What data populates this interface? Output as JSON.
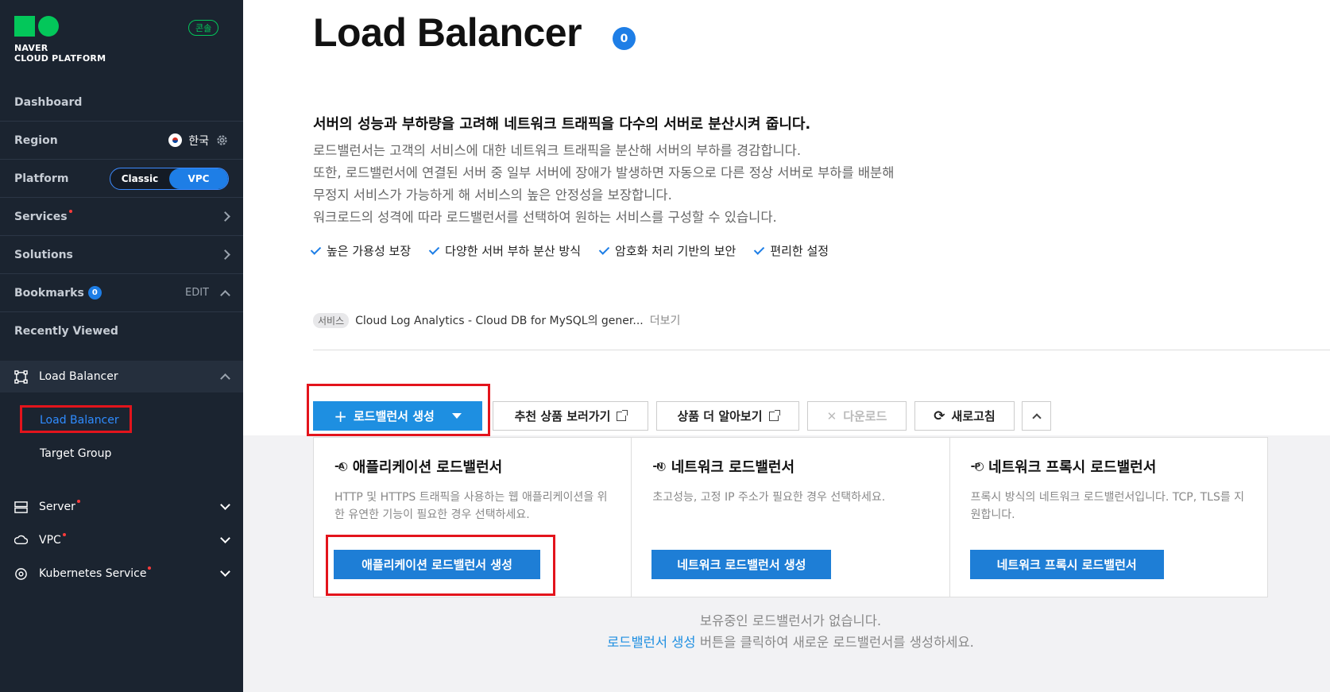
{
  "sidebar": {
    "logo_line1": "NAVER",
    "logo_line2": "CLOUD PLATFORM",
    "console_badge": "콘솔",
    "dashboard": "Dashboard",
    "region_label": "Region",
    "region_value": "한국",
    "platform_label": "Platform",
    "platform_options": [
      "Classic",
      "VPC"
    ],
    "platform_selected": "VPC",
    "services": "Services",
    "solutions": "Solutions",
    "bookmarks": "Bookmarks",
    "bookmarks_count": "0",
    "bookmarks_edit": "EDIT",
    "recently_viewed": "Recently Viewed",
    "current_service": "Load Balancer",
    "sub_items": [
      "Load Balancer",
      "Target Group"
    ],
    "service_list": [
      {
        "label": "Server",
        "icon": "server-icon"
      },
      {
        "label": "VPC",
        "icon": "vpc-icon"
      },
      {
        "label": "Kubernetes Service",
        "icon": "kubernetes-icon"
      }
    ]
  },
  "main": {
    "title": "Load Balancer",
    "count": "0",
    "headline": "서버의 성능과 부하량을 고려해 네트워크 트래픽을 다수의 서버로 분산시켜 줍니다.",
    "desc": [
      "로드밸런서는 고객의 서비스에 대한 네트워크 트래픽을 분산해 서버의 부하를 경감합니다.",
      "또한, 로드밸런서에 연결된 서버 중 일부 서버에 장애가 발생하면 자동으로 다른 정상 서버로 부하를 배분해",
      "무정지 서비스가 가능하게 해 서비스의 높은 안정성을 보장합니다.",
      "워크로드의 성격에 따라 로드밸런서를 선택하여 원하는 서비스를 구성할 수 있습니다."
    ],
    "features": [
      "높은 가용성 보장",
      "다양한 서버 부하 분산 방식",
      "암호화 처리 기반의 보안",
      "편리한 설정"
    ],
    "service_chip": "서비스",
    "service_text": "Cloud Log Analytics - Cloud DB for MySQL의 gener...",
    "service_more": "더보기",
    "toolbar": {
      "create": "로드밸런서 생성",
      "recommend": "추천 상품 보러가기",
      "learn_more": "상품 더 알아보기",
      "download": "다운로드",
      "refresh": "새로고침"
    },
    "cards": [
      {
        "icon_letter": "A",
        "title": "애플리케이션 로드밸런서",
        "desc": "HTTP 및 HTTPS 트래픽을 사용하는 웹 애플리케이션을 위한 유연한 기능이 필요한 경우 선택하세요.",
        "button": "애플리케이션 로드밸런서 생성"
      },
      {
        "icon_letter": "N",
        "title": "네트워크 로드밸런서",
        "desc": "초고성능, 고정 IP 주소가 필요한 경우 선택하세요.",
        "button": "네트워크 로드밸런서 생성"
      },
      {
        "icon_letter": "P",
        "title": "네트워크 프록시 로드밸런서",
        "desc": "프록시 방식의 네트워크 로드밸런서입니다. TCP, TLS를 지원합니다.",
        "button": "네트워크 프록시 로드밸런서"
      }
    ],
    "empty_line1": "보유중인 로드밸런서가 없습니다.",
    "empty_link": "로드밸런서 생성",
    "empty_line2": " 버튼을 클릭하여 새로운 로드밸런서를 생성하세요."
  }
}
